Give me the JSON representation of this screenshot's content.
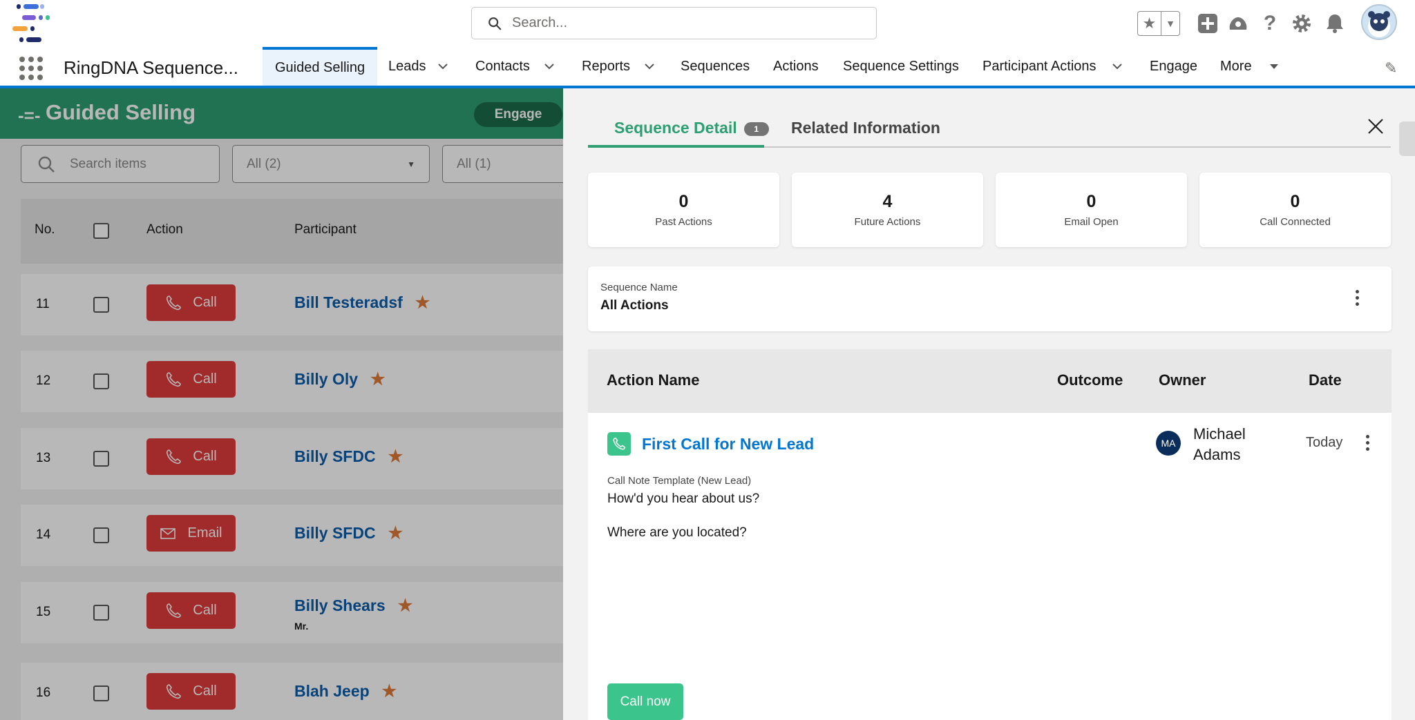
{
  "header": {
    "search_placeholder": "Search...",
    "app_name": "RingDNA Sequence..."
  },
  "nav": {
    "items": [
      {
        "label": "Guided Selling",
        "dropdown": false,
        "active": true
      },
      {
        "label": "Leads",
        "dropdown": true
      },
      {
        "label": "Contacts",
        "dropdown": true
      },
      {
        "label": "Reports",
        "dropdown": true
      },
      {
        "label": "Sequences",
        "dropdown": false
      },
      {
        "label": "Actions",
        "dropdown": false
      },
      {
        "label": "Sequence Settings",
        "dropdown": false
      },
      {
        "label": "Participant Actions",
        "dropdown": true
      },
      {
        "label": "Engage",
        "dropdown": false
      },
      {
        "label": "More",
        "dropdown": true
      }
    ]
  },
  "background_page": {
    "title": "Guided Selling",
    "engage_label": "Engage",
    "search_placeholder": "Search items",
    "filter_1": "All (2)",
    "filter_2": "All (1)",
    "columns": [
      "No.",
      "Action",
      "Participant"
    ],
    "rows": [
      {
        "no": "11",
        "action": "Call",
        "name": "Bill Testeradsf",
        "sub": ""
      },
      {
        "no": "12",
        "action": "Call",
        "name": "Billy Oly",
        "sub": ""
      },
      {
        "no": "13",
        "action": "Call",
        "name": "Billy SFDC",
        "sub": ""
      },
      {
        "no": "14",
        "action": "Email",
        "name": "Billy SFDC",
        "sub": ""
      },
      {
        "no": "15",
        "action": "Call",
        "name": "Billy Shears",
        "sub": "Mr."
      },
      {
        "no": "16",
        "action": "Call",
        "name": "Blah Jeep",
        "sub": ""
      }
    ]
  },
  "panel": {
    "tabs": {
      "detail": "Sequence Detail",
      "detail_badge": "1",
      "related": "Related Information"
    },
    "stats": [
      {
        "value": "0",
        "label": "Past Actions"
      },
      {
        "value": "4",
        "label": "Future Actions"
      },
      {
        "value": "0",
        "label": "Email Open"
      },
      {
        "value": "0",
        "label": "Call Connected"
      }
    ],
    "sequence": {
      "label": "Sequence Name",
      "value": "All Actions"
    },
    "table": {
      "headers": {
        "name": "Action Name",
        "outcome": "Outcome",
        "owner": "Owner",
        "date": "Date"
      },
      "action": {
        "name": "First Call for New Lead",
        "owner_initials": "MA",
        "owner_name": "Michael Adams",
        "date": "Today",
        "template_label": "Call Note Template (New Lead)",
        "note_line_1": "How'd you hear about us?",
        "note_line_2": "Where are you located?",
        "call_now": "Call now"
      }
    }
  },
  "colors": {
    "brand_blue": "#0176d3",
    "guided_green": "#2e9e73",
    "call_red": "#e03b3b",
    "action_green": "#3bc48b"
  }
}
